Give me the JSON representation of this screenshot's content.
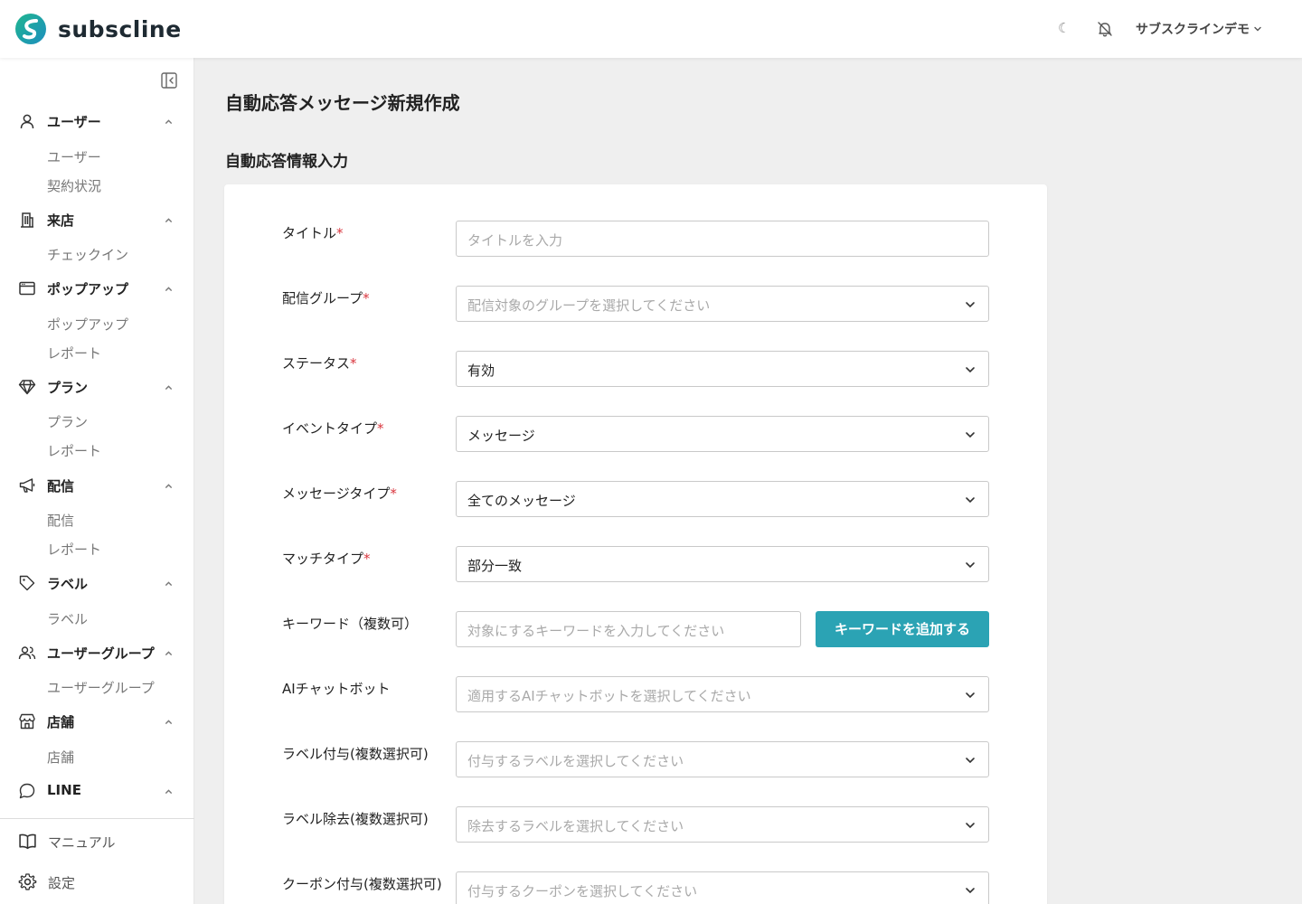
{
  "header": {
    "brand": "subscline",
    "theme_toggle_glyph": "☾",
    "account_name": "サブスクラインデモ",
    "icons": [
      "logo-mark",
      "moon-icon",
      "bell-off-icon",
      "chevron-down-icon"
    ]
  },
  "sidebar": {
    "groups": [
      {
        "label": "ユーザー",
        "icon": "user-icon",
        "items": [
          "ユーザー",
          "契約状況"
        ]
      },
      {
        "label": "来店",
        "icon": "building-icon",
        "items": [
          "チェックイン"
        ]
      },
      {
        "label": "ポップアップ",
        "icon": "window-icon",
        "items": [
          "ポップアップ",
          "レポート"
        ]
      },
      {
        "label": "プラン",
        "icon": "gem-icon",
        "items": [
          "プラン",
          "レポート"
        ]
      },
      {
        "label": "配信",
        "icon": "megaphone-icon",
        "items": [
          "配信",
          "レポート"
        ]
      },
      {
        "label": "ラベル",
        "icon": "tag-icon",
        "items": [
          "ラベル"
        ]
      },
      {
        "label": "ユーザーグループ",
        "icon": "users-icon",
        "items": [
          "ユーザーグループ"
        ]
      },
      {
        "label": "店舗",
        "icon": "store-icon",
        "items": [
          "店舗"
        ]
      },
      {
        "label": "LINE",
        "icon": "chat-bubble-icon",
        "items": []
      }
    ],
    "bottom": [
      {
        "label": "マニュアル",
        "icon": "book-icon"
      },
      {
        "label": "設定",
        "icon": "gear-icon"
      }
    ]
  },
  "main": {
    "page_title": "自動応答メッセージ新規作成",
    "section_title": "自動応答情報入力",
    "required_mark": "*",
    "form": {
      "title": {
        "label": "タイトル",
        "placeholder": "タイトルを入力"
      },
      "group": {
        "label": "配信グループ",
        "placeholder": "配信対象のグループを選択してください"
      },
      "status": {
        "label": "ステータス",
        "value": "有効"
      },
      "event_type": {
        "label": "イベントタイプ",
        "value": "メッセージ"
      },
      "message_type": {
        "label": "メッセージタイプ",
        "value": "全てのメッセージ"
      },
      "match_type": {
        "label": "マッチタイプ",
        "value": "部分一致"
      },
      "keyword": {
        "label": "キーワード（複数可）",
        "placeholder": "対象にするキーワードを入力してください",
        "button": "キーワードを追加する"
      },
      "ai_chatbot": {
        "label": "AIチャットボット",
        "placeholder": "適用するAIチャットボットを選択してください"
      },
      "label_add": {
        "label": "ラベル付与(複数選択可)",
        "placeholder": "付与するラベルを選択してください"
      },
      "label_remove": {
        "label": "ラベル除去(複数選択可)",
        "placeholder": "除去するラベルを選択してください"
      },
      "coupon_add": {
        "label": "クーポン付与(複数選択可)",
        "placeholder": "付与するクーポンを選択してください"
      }
    }
  },
  "colors": {
    "accent": "#2ba3b4",
    "required": "#d9363e",
    "background": "#efefef"
  }
}
